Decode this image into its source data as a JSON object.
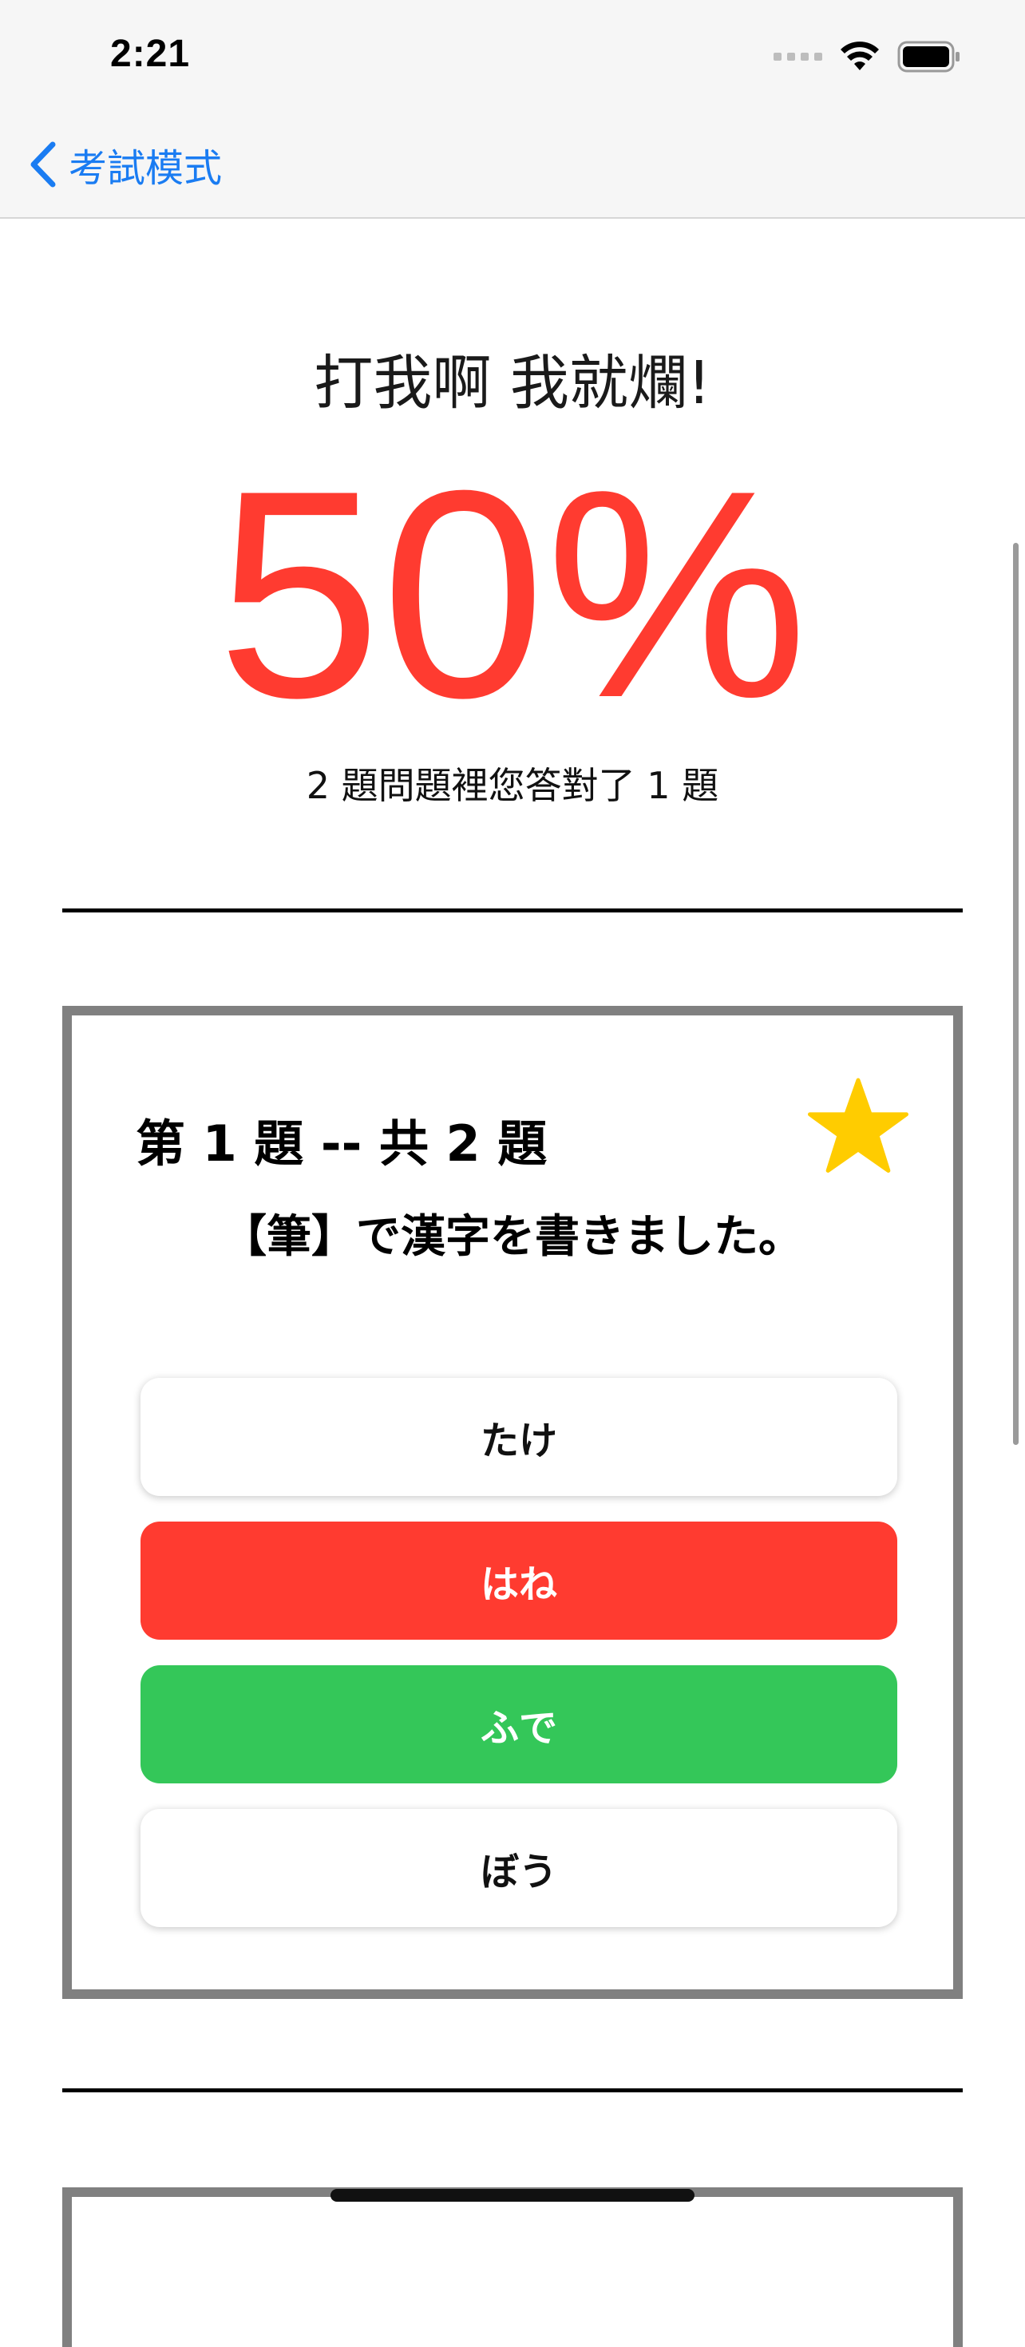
{
  "status_bar": {
    "time": "2:21"
  },
  "nav": {
    "back_label": "考試模式"
  },
  "result": {
    "title": "打我啊 我就爛!",
    "percent": "50%",
    "summary": "2 題問題裡您答對了 1 題"
  },
  "question": {
    "number_label": "第 1 題 -- 共 2 題",
    "text": "【筆】で漢字を書きました。",
    "starred": true,
    "options": [
      {
        "label": "たけ",
        "state": "neutral"
      },
      {
        "label": "はね",
        "state": "wrong"
      },
      {
        "label": "ふで",
        "state": "correct"
      },
      {
        "label": "ぼう",
        "state": "neutral"
      }
    ]
  },
  "colors": {
    "accent_blue": "#1a7cf2",
    "wrong_red": "#ff3b30",
    "correct_green": "#34c759",
    "star_yellow": "#ffcc00",
    "card_border": "#808080"
  }
}
